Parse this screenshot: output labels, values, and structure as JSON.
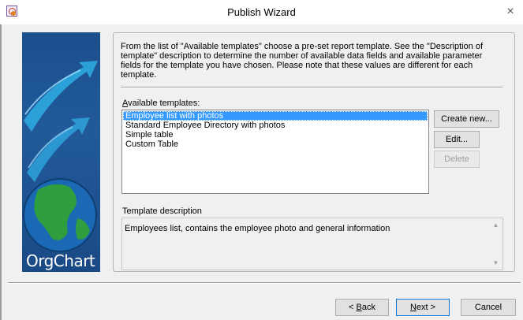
{
  "window": {
    "title": "Publish Wizard",
    "app_icon": "wizard-app-icon",
    "close_glyph": "×"
  },
  "banner": {
    "label": "OrgChart",
    "colors": {
      "background": "#1f5596",
      "swoosh": "#2ea8e0",
      "globe_land": "#2f9e3f",
      "globe_sea": "#1b68b5"
    }
  },
  "intro_text": "From the list of \"Available templates\" choose a pre-set report template. See the \"Description of template\" description to determine the number of available data fields and available parameter fields for the template you have chosen. Please note that these values are different for each template.",
  "templates": {
    "label_accel": "A",
    "label_rest": "vailable templates:",
    "items": [
      {
        "label": "Employee list with photos",
        "selected": true
      },
      {
        "label": "Standard Employee Directory with photos",
        "selected": false
      },
      {
        "label": "Simple table",
        "selected": false
      },
      {
        "label": "Custom Table",
        "selected": false
      }
    ],
    "selection_color": "#3399ff"
  },
  "side_buttons": {
    "create_new": "Create new...",
    "edit": "Edit...",
    "delete": "Delete"
  },
  "description": {
    "label": "Template description",
    "text": "Employees list, contains the employee photo and general information",
    "scroll_up_icon": "▲",
    "scroll_down_icon": "▼"
  },
  "footer_buttons": {
    "back_prefix": "< ",
    "back_accel": "B",
    "back_rest": "ack",
    "next_accel": "N",
    "next_rest": "ext >",
    "cancel": "Cancel"
  }
}
